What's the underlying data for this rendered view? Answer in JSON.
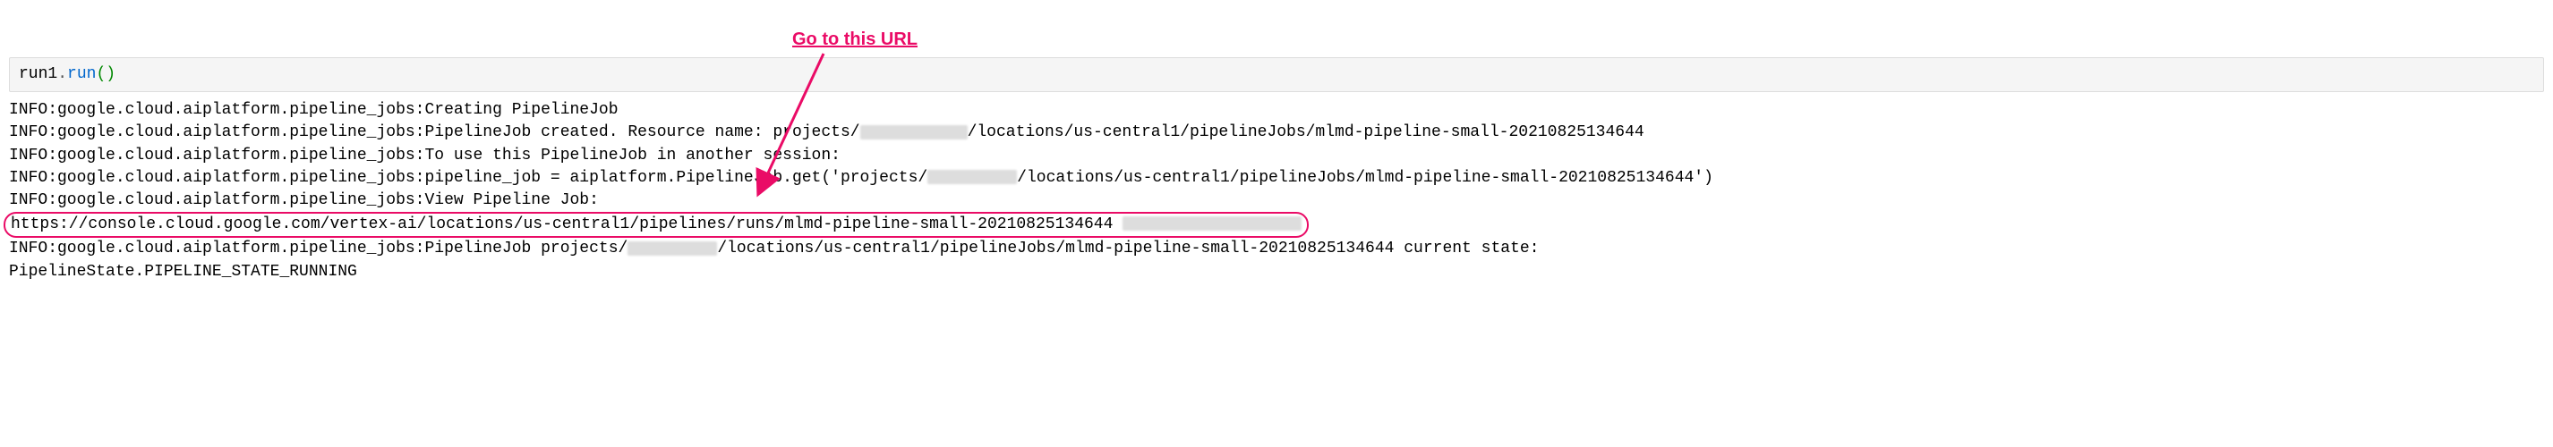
{
  "annotation": {
    "label": "Go to this URL"
  },
  "code": {
    "object": "run1",
    "method": "run",
    "parens": "()"
  },
  "output": {
    "lines": [
      {
        "prefix": "INFO:google.cloud.aiplatform.pipeline_jobs:Creating PipelineJob"
      },
      {
        "prefix": "INFO:google.cloud.aiplatform.pipeline_jobs:PipelineJob created. Resource name: projects/",
        "suffix": "/locations/us-central1/pipelineJobs/mlmd-pipeline-small-20210825134644"
      },
      {
        "prefix": "INFO:google.cloud.aiplatform.pipeline_jobs:To use this PipelineJob in another session:"
      },
      {
        "prefix": "INFO:google.cloud.aiplatform.pipeline_jobs:pipeline_job = aiplatform.PipelineJob.get('projects/",
        "suffix": "/locations/us-central1/pipelineJobs/mlmd-pipeline-small-20210825134644')"
      },
      {
        "prefix": "INFO:google.cloud.aiplatform.pipeline_jobs:View Pipeline Job:"
      },
      {
        "url": "https://console.cloud.google.com/vertex-ai/locations/us-central1/pipelines/runs/mlmd-pipeline-small-20210825134644"
      },
      {
        "prefix": "INFO:google.cloud.aiplatform.pipeline_jobs:PipelineJob projects/",
        "suffix": "/locations/us-central1/pipelineJobs/mlmd-pipeline-small-20210825134644 current state:"
      },
      {
        "prefix": "PipelineState.PIPELINE_STATE_RUNNING"
      }
    ]
  }
}
